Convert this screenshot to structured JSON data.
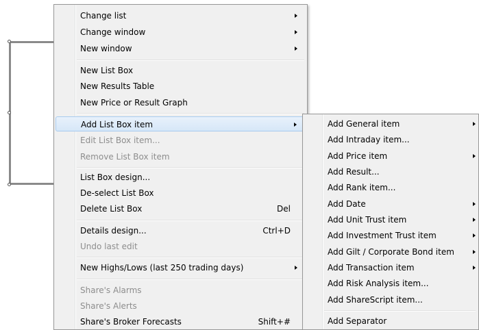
{
  "main_menu": {
    "items": [
      {
        "label": "Change list",
        "shortcut": "",
        "submenu": true,
        "disabled": false
      },
      {
        "label": "Change window",
        "shortcut": "",
        "submenu": true,
        "disabled": false
      },
      {
        "label": "New window",
        "shortcut": "",
        "submenu": true,
        "disabled": false
      },
      {
        "label": "New List Box",
        "shortcut": "",
        "submenu": false,
        "disabled": false
      },
      {
        "label": "New Results Table",
        "shortcut": "",
        "submenu": false,
        "disabled": false
      },
      {
        "label": "New Price or Result Graph",
        "shortcut": "",
        "submenu": false,
        "disabled": false
      },
      {
        "label": "Add List Box item",
        "shortcut": "",
        "submenu": true,
        "disabled": false,
        "highlighted": true
      },
      {
        "label": "Edit List Box item...",
        "shortcut": "",
        "submenu": false,
        "disabled": true
      },
      {
        "label": "Remove List Box item",
        "shortcut": "",
        "submenu": false,
        "disabled": true
      },
      {
        "label": "List Box design...",
        "shortcut": "",
        "submenu": false,
        "disabled": false
      },
      {
        "label": "De-select List Box",
        "shortcut": "",
        "submenu": false,
        "disabled": false
      },
      {
        "label": "Delete List Box",
        "shortcut": "Del",
        "submenu": false,
        "disabled": false
      },
      {
        "label": "Details design...",
        "shortcut": "Ctrl+D",
        "submenu": false,
        "disabled": false
      },
      {
        "label": "Undo last edit",
        "shortcut": "",
        "submenu": false,
        "disabled": true
      },
      {
        "label": "New Highs/Lows (last 250 trading days)",
        "shortcut": "",
        "submenu": true,
        "disabled": false
      },
      {
        "label": "Share's Alarms",
        "shortcut": "",
        "submenu": false,
        "disabled": true
      },
      {
        "label": "Share's Alerts",
        "shortcut": "",
        "submenu": false,
        "disabled": true
      },
      {
        "label": "Share's Broker Forecasts",
        "shortcut": "Shift+#",
        "submenu": false,
        "disabled": false
      }
    ]
  },
  "sub_menu": {
    "items": [
      {
        "label": "Add General item",
        "submenu": true
      },
      {
        "label": "Add Intraday item...",
        "submenu": false
      },
      {
        "label": "Add Price item",
        "submenu": true
      },
      {
        "label": "Add Result...",
        "submenu": false
      },
      {
        "label": "Add Rank item...",
        "submenu": false
      },
      {
        "label": "Add Date",
        "submenu": true
      },
      {
        "label": "Add Unit Trust item",
        "submenu": true
      },
      {
        "label": "Add Investment Trust item",
        "submenu": true
      },
      {
        "label": "Add Gilt / Corporate Bond item",
        "submenu": true
      },
      {
        "label": "Add Transaction item",
        "submenu": true
      },
      {
        "label": "Add Risk Analysis item...",
        "submenu": false
      },
      {
        "label": "Add ShareScript item...",
        "submenu": false
      },
      {
        "label": "Add Separator",
        "submenu": false
      }
    ]
  },
  "icons": {
    "submenu_arrow": "triangle-right-icon"
  }
}
